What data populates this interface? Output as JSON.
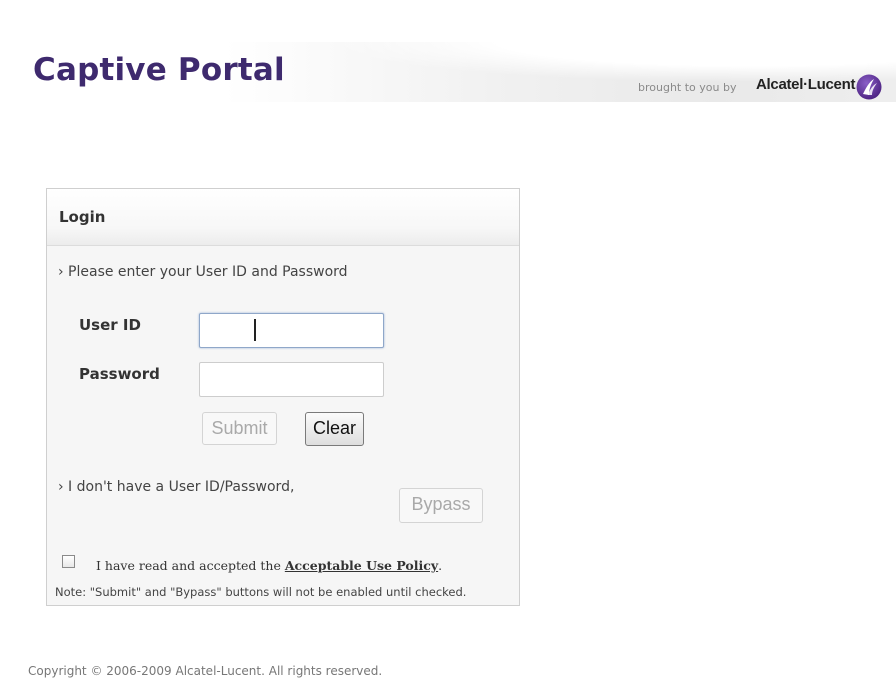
{
  "header": {
    "title": "Captive Portal",
    "brought_by": "brought to you by",
    "brand": "Alcatel·Lucent",
    "brand_logo_icon": "alcatel-lucent-logo-icon",
    "title_color": "#3e2a6e",
    "logo_color": "#5a2d91"
  },
  "login": {
    "title": "Login",
    "instruction": "› Please enter your User ID and Password",
    "user_id_label": "User ID",
    "user_id_value": "",
    "password_label": "Password",
    "password_value": "",
    "submit_label": "Submit",
    "clear_label": "Clear",
    "no_id_text": "› I don't have a User ID/Password,",
    "bypass_label": "Bypass",
    "aup_checked": false,
    "aup_prefix": "I have read and accepted the ",
    "aup_link": "Acceptable Use Policy",
    "aup_suffix": ".",
    "note": "Note: \"Submit\" and \"Bypass\" buttons will not be enabled until checked."
  },
  "footer": {
    "copyright": "Copyright © 2006-2009 Alcatel-Lucent. All rights reserved."
  }
}
